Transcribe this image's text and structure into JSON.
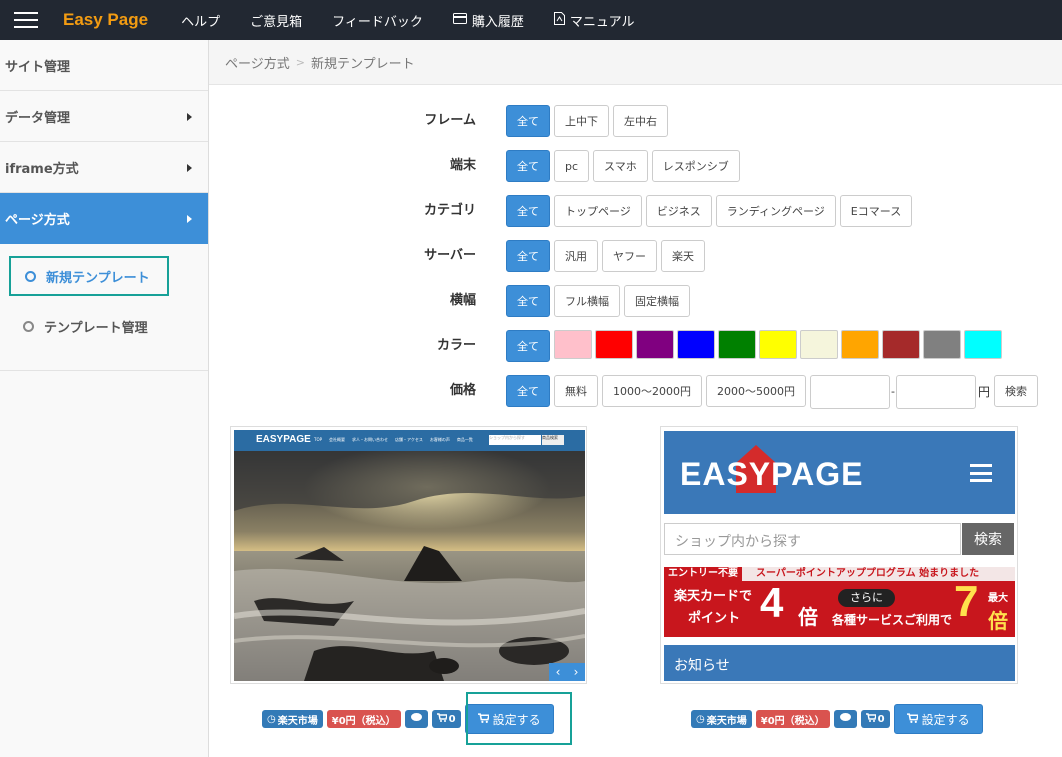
{
  "nav": {
    "brand": "Easy Page",
    "links": [
      "ヘルプ",
      "ご意見箱",
      "フィードバック",
      "購入履歴",
      "マニュアル"
    ]
  },
  "sidebar": {
    "items": [
      "サイト管理",
      "データ管理",
      "iframe方式",
      "ページ方式"
    ],
    "submenu": [
      "新規テンプレート",
      "テンプレート管理"
    ]
  },
  "breadcrumb": [
    "ページ方式",
    "新規テンプレート"
  ],
  "filters": {
    "frame": {
      "label": "フレーム",
      "options": [
        "全て",
        "上中下",
        "左中右"
      ]
    },
    "device": {
      "label": "端末",
      "options": [
        "全て",
        "pc",
        "スマホ",
        "レスポンシブ"
      ]
    },
    "category": {
      "label": "カテゴリ",
      "options": [
        "全て",
        "トップページ",
        "ビジネス",
        "ランディングページ",
        "Eコマース"
      ]
    },
    "server": {
      "label": "サーバー",
      "options": [
        "全て",
        "汎用",
        "ヤフー",
        "楽天"
      ]
    },
    "width": {
      "label": "横幅",
      "options": [
        "全て",
        "フル横幅",
        "固定横幅"
      ]
    },
    "color": {
      "label": "カラー",
      "all": "全て",
      "swatches": [
        "#ffc0cb",
        "#ff0000",
        "#800080",
        "#0000ff",
        "#008000",
        "#ffff00",
        "#f5f5dc",
        "#ffa500",
        "#a52a2a",
        "#808080",
        "#00ffff"
      ]
    },
    "price": {
      "label": "価格",
      "options": [
        "全て",
        "無料",
        "1000〜2000円",
        "2000〜5000円"
      ],
      "dash": "-",
      "unit": "円",
      "search": "検索"
    }
  },
  "templates": [
    {
      "preview": {
        "logo": "EASYPAGE",
        "menu": [
          "TOP",
          "会社概要",
          "求人・お問い合わせ",
          "店舗・アクセス",
          "お客様の声",
          "商品一覧"
        ],
        "search_placeholder": "ショップ内から探す",
        "search_button": "商品検索",
        "slider_prev": "‹",
        "slider_next": "›"
      },
      "shop": "楽天市場",
      "price": "¥0円（税込）",
      "comments": "",
      "cart": "0",
      "button": "設定する"
    },
    {
      "preview": {
        "logo": "EASYPAGE",
        "search_placeholder": "ショップ内から探す",
        "search_button": "検索",
        "banner_top_left": "エントリー不要",
        "banner_top_right": "スーパーポイントアッププログラム 始まりました",
        "banner_card": "楽天カードで",
        "banner_point": "ポイント",
        "banner_times": "4",
        "banner_bai": "倍",
        "banner_more": "さらに",
        "banner_services": "各種サービスご利用で",
        "banner_max": "最大",
        "banner_times2": "7",
        "banner_bai2": "倍",
        "notice": "お知らせ"
      },
      "shop": "楽天市場",
      "price": "¥0円（税込）",
      "comments": "",
      "cart": "0",
      "button": "設定する"
    }
  ]
}
